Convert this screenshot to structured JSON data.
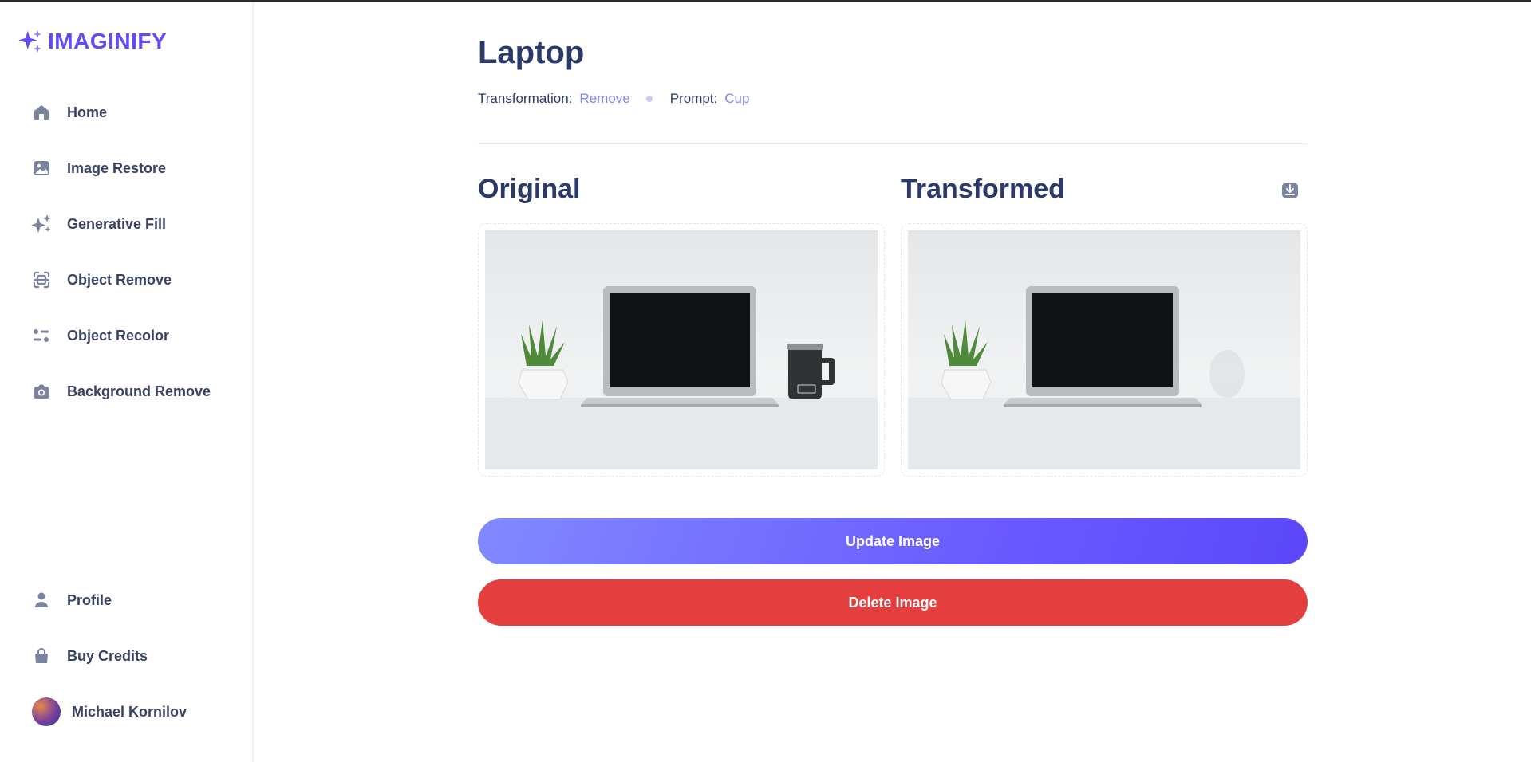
{
  "app": {
    "name": "IMAGINIFY"
  },
  "sidebar": {
    "items": [
      {
        "label": "Home",
        "icon": "home-icon"
      },
      {
        "label": "Image Restore",
        "icon": "image-icon"
      },
      {
        "label": "Generative Fill",
        "icon": "sparkles-icon"
      },
      {
        "label": "Object Remove",
        "icon": "scan-icon"
      },
      {
        "label": "Object Recolor",
        "icon": "filter-icon"
      },
      {
        "label": "Background Remove",
        "icon": "camera-icon"
      }
    ],
    "bottom": [
      {
        "label": "Profile",
        "icon": "user-icon"
      },
      {
        "label": "Buy Credits",
        "icon": "bag-icon"
      }
    ],
    "user": {
      "name": "Michael Kornilov"
    }
  },
  "main": {
    "title": "Laptop",
    "transformation_label": "Transformation:",
    "transformation_value": "Remove",
    "prompt_label": "Prompt:",
    "prompt_value": "Cup",
    "original_title": "Original",
    "transformed_title": "Transformed",
    "update_button": "Update Image",
    "delete_button": "Delete Image"
  },
  "colors": {
    "accent": "#624cf5",
    "link": "#7f86f0",
    "danger": "#e53e3e",
    "heading": "#2b3a6b"
  }
}
